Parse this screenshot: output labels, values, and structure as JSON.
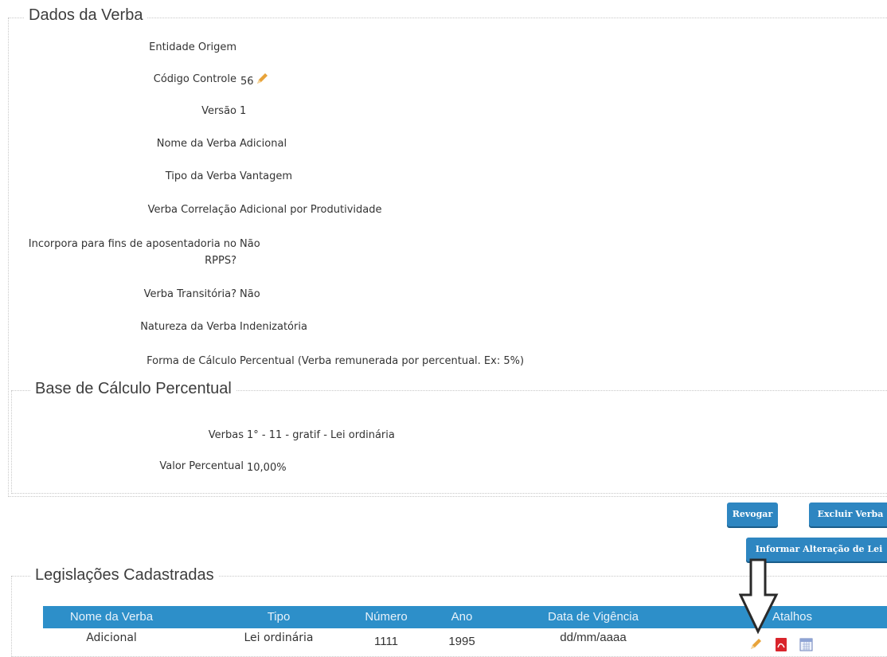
{
  "dados": {
    "legend": "Dados da Verba",
    "fields": [
      {
        "label": "Entidade Origem",
        "value": ""
      },
      {
        "label": "Código Controle",
        "value": "56"
      },
      {
        "label": "Versão",
        "value": "1"
      },
      {
        "label": "Nome da Verba",
        "value": "Adicional"
      },
      {
        "label": "Tipo da Verba",
        "value": "Vantagem"
      },
      {
        "label": "Verba Correlação",
        "value": "Adicional por Produtividade"
      },
      {
        "label_line1": "Incorpora para fins de aposentadoria no",
        "label_line2": "RPPS?",
        "value": "Não"
      },
      {
        "label": "Verba Transitória?",
        "value": "Não"
      },
      {
        "label": "Natureza da Verba",
        "value": "Indenizatória"
      },
      {
        "label": "Forma de Cálculo",
        "value": "Percentual (Verba remunerada por percentual. Ex: 5%)"
      }
    ]
  },
  "base": {
    "legend": "Base de Cálculo Percentual",
    "fields": [
      {
        "label": "Verbas",
        "value": "1° - 11 - gratif - Lei ordinária"
      },
      {
        "label": "Valor Percentual",
        "value": "10,00%"
      }
    ]
  },
  "buttons": {
    "revogar": "Revogar",
    "excluir": "Excluir Verba",
    "informar": "Informar Alteração de Lei"
  },
  "legislacoes": {
    "legend": "Legislações Cadastradas",
    "columns": [
      "Nome da Verba",
      "Tipo",
      "Número",
      "Ano",
      "Data de Vigência",
      "Atalhos"
    ],
    "rows": [
      {
        "nome": "Adicional",
        "tipo": "Lei ordinária",
        "numero": "1111",
        "ano": "1995",
        "data": "dd/mm/aaaa",
        "atalhos": [
          "pencil-icon",
          "pdf-icon",
          "calendar-icon"
        ]
      }
    ]
  },
  "colors": {
    "accent": "#2e86c1",
    "header": "#2d8fc9",
    "pdf": "#d9242b",
    "pencil": "#e8a33a"
  }
}
